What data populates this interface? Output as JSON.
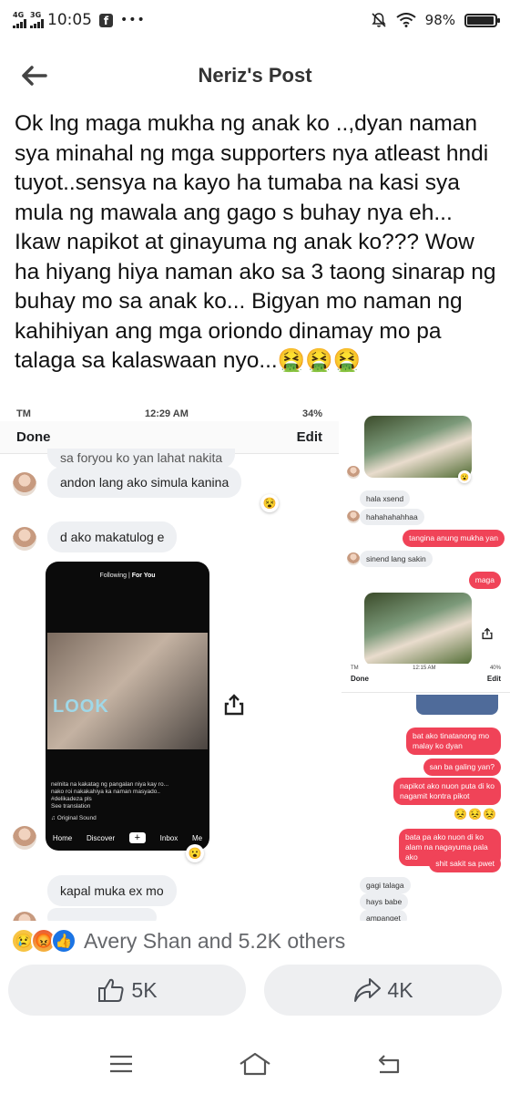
{
  "status_bar": {
    "network_1": "4G",
    "network_2": "3G",
    "time": "10:05",
    "battery_text": "98%",
    "battery_level": 0.98
  },
  "header": {
    "title": "Neriz's Post"
  },
  "post": {
    "text": "Ok lng maga mukha ng anak ko ..,dyan naman sya minahal ng mga supporters nya atleast hndi tuyot..sensya na kayo ha tumaba na kasi sya mula ng mawala ang gago s buhay nya eh... Ikaw napikot at ginayuma ng anak ko??? Wow ha hiyang hiya naman ako sa 3 taong sinarap ng buhay mo sa anak ko... Bigyan mo naman ng kahihiyan ang mga oriondo dinamay mo pa talaga sa kalaswaan nyo...",
    "emojis": "🤮🤮🤮"
  },
  "screenshot_left": {
    "carrier": "TM",
    "time": "12:29 AM",
    "battery": "34%",
    "done_label": "Done",
    "edit_label": "Edit",
    "message_top_partial": "sa foryou ko yan lahat nakita",
    "message_1": "andon lang ako simula kanina",
    "message_2": "d ako makatulog e",
    "message_3": "kapal muka ex mo",
    "tiktok": {
      "following": "Following",
      "for_you": "For You",
      "look_text": "LOOK",
      "caption": "nelnita na kakatag ng pangalan niya kay ro... nako roi nakakahiya ka naman masyado.. #delikadeza pls",
      "see_translation": "See translation",
      "sound": "Original Sound",
      "nav": [
        "Home",
        "Discover",
        "+",
        "Inbox",
        "Me"
      ]
    }
  },
  "screenshot_right": {
    "grey_messages": [
      "hala xsend",
      "hahahahahhaa",
      "sinend lang sakin"
    ],
    "red_messages_top": [
      "tangina anung mukha yan",
      "maga"
    ],
    "overlay": {
      "carrier": "TM",
      "time": "12:15 AM",
      "battery": "40%",
      "done_label": "Done",
      "edit_label": "Edit"
    },
    "red_messages_bottom": [
      "bat ako tinatanong mo malay ko dyan",
      "san ba galing yan?",
      "napikot ako nuon puta di ko nagamit kontra pikot",
      "bata pa ako nuon di ko alam na nagayuma pala ako",
      "shit sakit sa pwet"
    ],
    "reaction_emojis": "😣😣😣",
    "grey_messages_bottom": [
      "gagi talaga",
      "hays babe",
      "ampanget"
    ]
  },
  "reactions": {
    "summary": "Avery Shan and 5.2K others"
  },
  "actions": {
    "like_count": "5K",
    "share_count": "4K"
  }
}
